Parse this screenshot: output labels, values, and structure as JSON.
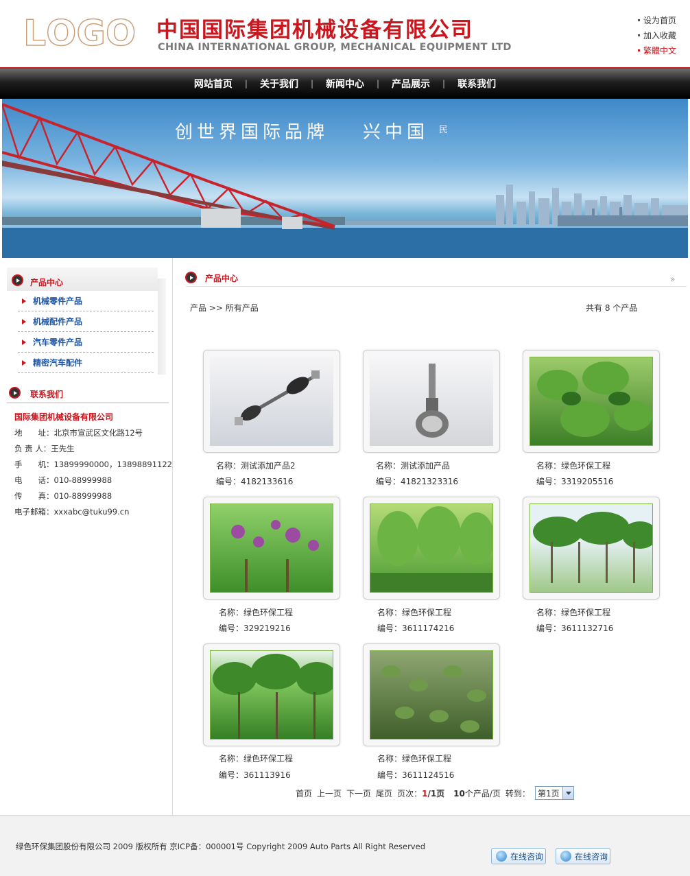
{
  "header": {
    "logo_letters": [
      "L",
      "O",
      "G",
      "O"
    ],
    "company_cn": "中国国际集团机械设备有限公司",
    "company_en": "CHINA INTERNATIONAL GROUP, MECHANICAL EQUIPMENT LTD",
    "links": [
      "设为首页",
      "加入收藏",
      "繁體中文"
    ]
  },
  "nav": {
    "items": [
      "网站首页",
      "关于我们",
      "新闻中心",
      "产品展示",
      "联系我们"
    ],
    "separator": "|"
  },
  "banner": {
    "slogan_1": "创世界国际品牌",
    "slogan_2": "兴中国",
    "slogan_3": "民"
  },
  "sidebar": {
    "product_title": "产品中心",
    "categories": [
      "机械零件产品",
      "机械配件产品",
      "汽车零件产品",
      "精密汽车配件"
    ],
    "contact_title": "联系我们",
    "contact": {
      "company": "国际集团机械设备有限公司",
      "address": "地　　址：北京市宣武区文化路12号",
      "person": "负 责 人：王先生",
      "mobile": "手　　机：13899990000，13898891122",
      "phone": "电　　话：010-88999988",
      "fax": "传　　真：010-88999988",
      "email": "电子邮箱：xxxabc@tuku99.cn"
    }
  },
  "main": {
    "title": "产品中心",
    "more_icon": "»",
    "breadcrumb": "产品 >> 所有产品",
    "total": "共有 8 个产品",
    "products": [
      {
        "name": "名称：测试添加产品2",
        "code": "编号：4182133616",
        "image": "drive-shaft"
      },
      {
        "name": "名称：测试添加产品",
        "code": "编号：41821323316",
        "image": "cv-joint"
      },
      {
        "name": "名称：绿色环保工程",
        "code": "编号：3319205516",
        "image": "leaves"
      },
      {
        "name": "名称：绿色环保工程",
        "code": "编号：329219216",
        "image": "flowering-trees"
      },
      {
        "name": "名称：绿色环保工程",
        "code": "编号：3611174216",
        "image": "willow-trees"
      },
      {
        "name": "名称：绿色环保工程",
        "code": "编号：3611132716",
        "image": "tree-grove"
      },
      {
        "name": "名称：绿色环保工程",
        "code": "编号：361113916",
        "image": "tall-trees"
      },
      {
        "name": "名称：绿色环保工程",
        "code": "编号：3611124516",
        "image": "hanging-leaves"
      }
    ],
    "pager": {
      "first": "首页",
      "prev": "上一页",
      "next": "下一页",
      "last": "尾页",
      "page_label": "页次：",
      "page_current": "1",
      "page_sep": "/1页",
      "per_page": "10",
      "per_page_label": "个产品/页",
      "goto": "转到：",
      "select_value": "第1页"
    }
  },
  "footer": {
    "copyright": "绿色环保集团股份有限公司 2009 版权所有 京ICP备：000001号 Copyright 2009 Auto Parts All Right Reserved",
    "consult_label": "在线咨询"
  },
  "colors": {
    "brand_red": "#c8171e",
    "link_blue": "#1f58a8",
    "nav_bg": "#000000"
  }
}
